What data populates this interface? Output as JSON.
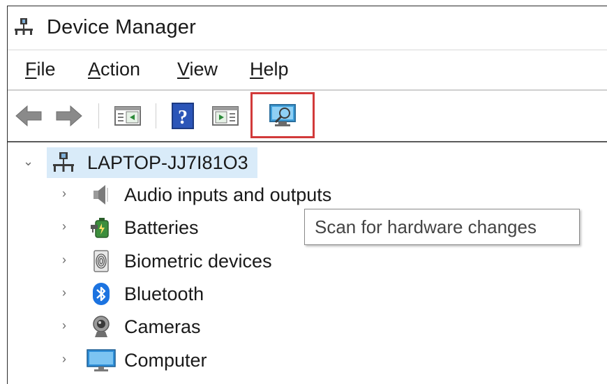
{
  "window": {
    "title": "Device Manager",
    "title_icon": "computer-network-icon"
  },
  "menubar": {
    "items": [
      {
        "accel": "F",
        "rest": "ile"
      },
      {
        "accel": "A",
        "rest": "ction"
      },
      {
        "accel": "V",
        "rest": "iew"
      },
      {
        "accel": "H",
        "rest": "elp"
      }
    ]
  },
  "toolbar": {
    "buttons": [
      "back-arrow-icon",
      "forward-arrow-icon",
      "show-hide-console-tree-icon",
      "help-icon",
      "action-pane-icon",
      "scan-hardware-icon"
    ],
    "highlighted": "scan-hardware-icon",
    "highlight_color": "#d23a3a"
  },
  "tree": {
    "root": {
      "label": "LAPTOP-JJ7I81O3",
      "expanded": true,
      "selected_color": "#d9ebf9"
    },
    "categories": [
      {
        "label": "Audio inputs and outputs",
        "icon": "speaker-icon"
      },
      {
        "label": "Batteries",
        "icon": "battery-icon"
      },
      {
        "label": "Biometric devices",
        "icon": "fingerprint-icon"
      },
      {
        "label": "Bluetooth",
        "icon": "bluetooth-icon"
      },
      {
        "label": "Cameras",
        "icon": "webcam-icon"
      },
      {
        "label": "Computer",
        "icon": "monitor-icon"
      }
    ]
  },
  "tooltip": {
    "text": "Scan for hardware changes"
  }
}
